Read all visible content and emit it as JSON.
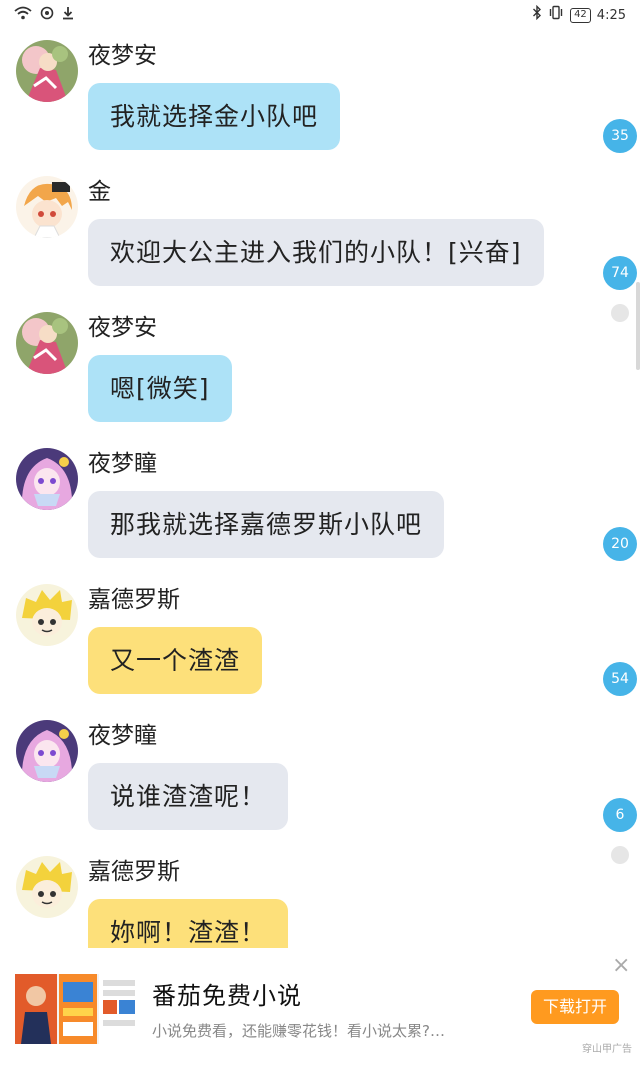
{
  "status_bar": {
    "time": "4:25",
    "battery": "42",
    "left_icons": [
      "wifi-icon",
      "data-saver-icon",
      "download-icon"
    ],
    "right_icons": [
      "bluetooth-icon",
      "vibrate-icon"
    ]
  },
  "messages": [
    {
      "sender": "夜梦安",
      "text": "我就选择金小队吧",
      "bubble_color": "#ade2f7"
    },
    {
      "sender": "金",
      "text": "欢迎大公主进入我们的小队！[兴奋]",
      "bubble_color": "#e5e8ef"
    },
    {
      "sender": "夜梦安",
      "text": "嗯[微笑]",
      "bubble_color": "#ade2f7"
    },
    {
      "sender": "夜梦瞳",
      "text": "那我就选择嘉德罗斯小队吧",
      "bubble_color": "#e5e8ef"
    },
    {
      "sender": "嘉德罗斯",
      "text": "又一个渣渣",
      "bubble_color": "#fde07a"
    },
    {
      "sender": "夜梦瞳",
      "text": "说谁渣渣呢！",
      "bubble_color": "#e5e8ef"
    },
    {
      "sender": "嘉德罗斯",
      "text": "妳啊！渣渣！",
      "bubble_color": "#fde07a"
    }
  ],
  "side_badges": [
    "35",
    "74",
    "20",
    "54",
    "6"
  ],
  "ad": {
    "title": "番茄免费小说",
    "description": "小说免费看，还能赚零花钱！看小说太累?…",
    "button_label": "下载打开",
    "close_label": "×",
    "source_label": "穿山甲广告",
    "accent_color": "#ff9a1f"
  }
}
